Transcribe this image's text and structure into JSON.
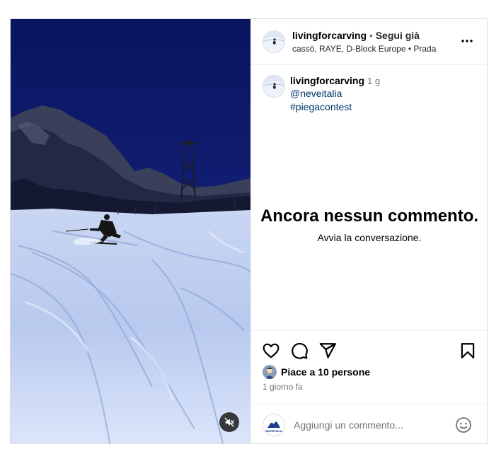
{
  "post": {
    "username": "livingforcarving",
    "separator": "•",
    "follow_label": "Segui già",
    "audio": "cassö, RAYE, D-Block Europe • Prada"
  },
  "caption": {
    "username": "livingforcarving",
    "time": "1 g",
    "lines": [
      "@neveitalia",
      "#piegacontest"
    ]
  },
  "comments": {
    "empty_title": "Ancora nessun commento.",
    "empty_subtitle": "Avvia la conversazione."
  },
  "engagement": {
    "likes": "Piace a 10 persone",
    "date": "1 giorno fa"
  },
  "comment_box": {
    "placeholder": "Aggiungi un commento...",
    "avatar_text": "NEVEITALIA"
  },
  "icons": {
    "more": "more-horizontal-icon",
    "like": "heart-icon",
    "comment": "comment-icon",
    "share": "send-icon",
    "save": "bookmark-icon",
    "mute": "speaker-muted-icon",
    "emoji": "smiley-icon"
  },
  "colors": {
    "link": "#00376b",
    "secondary": "#737373",
    "border": "#dbdbdb",
    "video_sky": "#0d1a6e"
  }
}
